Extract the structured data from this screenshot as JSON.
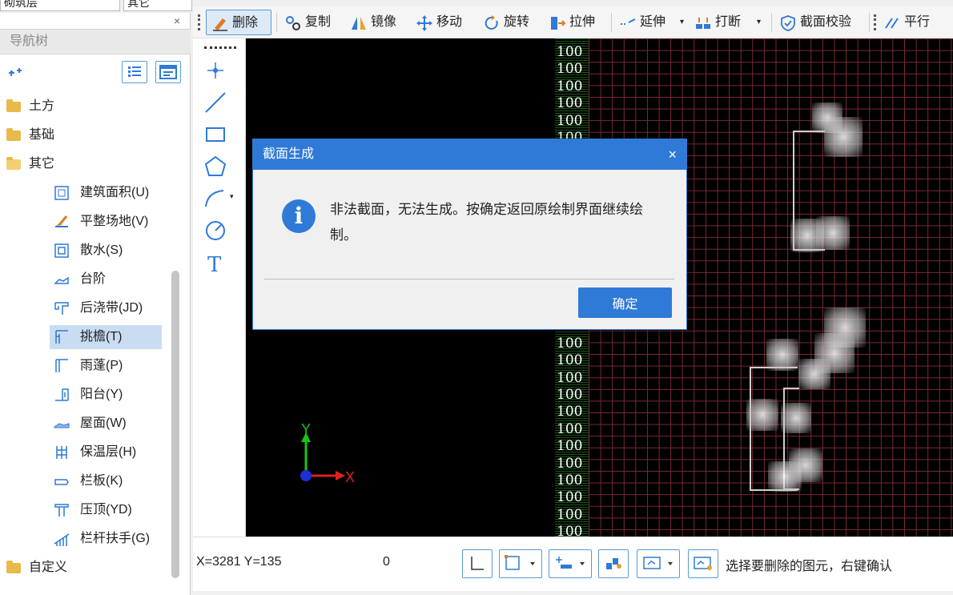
{
  "top_combos": [
    "砌筑层",
    "其它"
  ],
  "nav": {
    "title": "导航树",
    "close": "×",
    "folders": [
      {
        "label": "土方",
        "expanded": false
      },
      {
        "label": "基础",
        "expanded": false
      },
      {
        "label": "其它",
        "expanded": true
      },
      {
        "label": "自定义",
        "expanded": false
      }
    ],
    "items": [
      {
        "label": "建筑面积(U)",
        "icon": "building-area-icon"
      },
      {
        "label": "平整场地(V)",
        "icon": "site-leveling-icon"
      },
      {
        "label": "散水(S)",
        "icon": "apron-icon"
      },
      {
        "label": "台阶",
        "icon": "steps-icon"
      },
      {
        "label": "后浇带(JD)",
        "icon": "post-pour-strip-icon"
      },
      {
        "label": "挑檐(T)",
        "icon": "cornice-icon",
        "selected": true
      },
      {
        "label": "雨蓬(P)",
        "icon": "canopy-icon"
      },
      {
        "label": "阳台(Y)",
        "icon": "balcony-icon"
      },
      {
        "label": "屋面(W)",
        "icon": "roof-icon"
      },
      {
        "label": "保温层(H)",
        "icon": "insulation-icon"
      },
      {
        "label": "栏板(K)",
        "icon": "parapet-icon"
      },
      {
        "label": "压顶(YD)",
        "icon": "coping-icon"
      },
      {
        "label": "栏杆扶手(G)",
        "icon": "railing-icon"
      }
    ]
  },
  "toolbar": {
    "delete": "删除",
    "copy": "复制",
    "mirror": "镜像",
    "move": "移动",
    "rotate": "旋转",
    "stretch": "拉伸",
    "extend": "延伸",
    "break": "打断",
    "section_check": "截面校验",
    "parallel": "平行"
  },
  "canvas": {
    "ruler_label": "100",
    "axis_x": "X",
    "axis_y": "Y"
  },
  "status": {
    "coords": "X=3281 Y=135",
    "value": "0",
    "hint": "选择要删除的图元，右键确认"
  },
  "dialog": {
    "title": "截面生成",
    "close": "×",
    "icon": "i",
    "message": "非法截面，无法生成。按确定返回原绘制界面继续绘制。",
    "ok": "确定"
  },
  "colors": {
    "accent": "#2f7ad6",
    "grid": "#7a2a33",
    "canvas_bg": "#000000"
  }
}
